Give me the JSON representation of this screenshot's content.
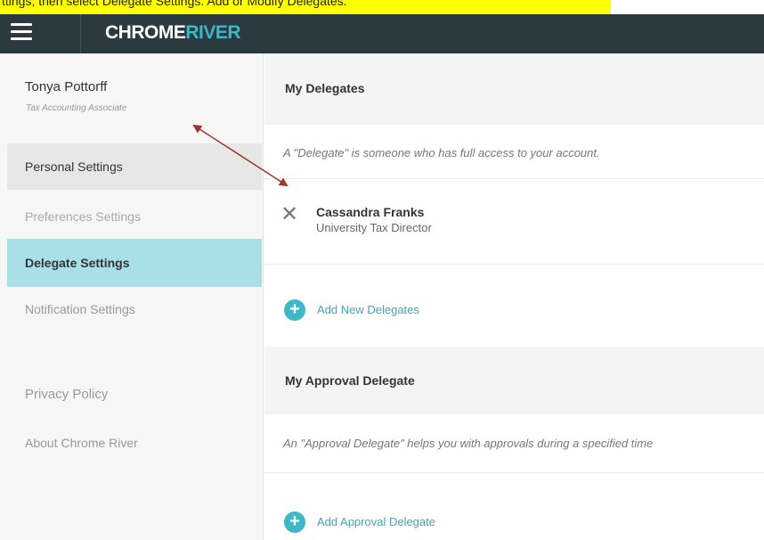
{
  "highlight": {
    "text": "ttings, then select Delegate Settings. Add or Modify Delegates."
  },
  "header": {
    "logo_part1": "CHROME",
    "logo_part2": "RIVER",
    "accent_color": "#3fb7c8"
  },
  "sidebar": {
    "user": {
      "name": "Tonya Pottorff",
      "title": "Tax Accounting Associate"
    },
    "items": [
      {
        "label": "Personal Settings"
      },
      {
        "label": "Preferences Settings"
      },
      {
        "label": "Delegate Settings",
        "active": true
      },
      {
        "label": "Notification Settings"
      },
      {
        "label": "Privacy Policy"
      },
      {
        "label": "About Chrome River"
      }
    ]
  },
  "main": {
    "delegates": {
      "title": "My Delegates",
      "description": "A \"Delegate\" is someone who has full access to your account.",
      "list": [
        {
          "name": "Cassandra Franks",
          "title": "University Tax Director"
        }
      ],
      "add_label": "Add New Delegates"
    },
    "approval": {
      "title": "My Approval Delegate",
      "description": "An \"Approval Delegate\" helps you with approvals during a specified time",
      "add_label": "Add Approval Delegate"
    }
  },
  "annotation": {
    "color": "#a0382a"
  }
}
